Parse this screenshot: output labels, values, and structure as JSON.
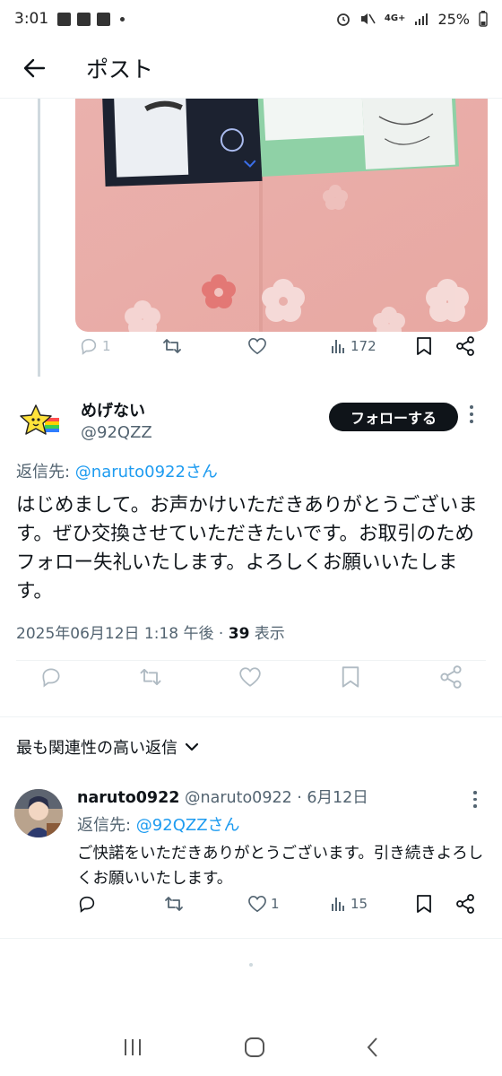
{
  "status_bar": {
    "time": "3:01",
    "network": "4G+",
    "battery": "25%"
  },
  "header": {
    "title": "ポスト"
  },
  "quoted_post_actions": {
    "replies": "1",
    "views": "172"
  },
  "post": {
    "author_name": "めげない",
    "author_handle": "@92QZZ",
    "follow_label": "フォローする",
    "reply_to_prefix": "返信先: ",
    "reply_to_mention": "@naruto0922さん",
    "text": "はじめまして。お声かけいただきありがとうございます。ぜひ交換させていただきたいです。お取引のためフォロー失礼いたします。よろしくお願いいたします。",
    "timestamp": "2025年06月12日 1:18 午後 · ",
    "view_count": "39",
    "view_suffix": " 表示"
  },
  "replies_section": {
    "sort_label": "最も関連性の高い返信"
  },
  "reply": {
    "author_name": "naruto0922",
    "author_meta": " @naruto0922 · 6月12日",
    "reply_to_prefix": "返信先: ",
    "reply_to_mention": "@92QZZさん",
    "text": "ご快諾をいただきありがとうございます。引き続きよろしくお願いいたします。",
    "likes": "1",
    "views": "15"
  },
  "colors": {
    "accent": "#1d9bf0",
    "text": "#0f1419",
    "muted": "#536471",
    "follow_bg": "#0f1419"
  },
  "icons": [
    "back-arrow-icon",
    "reply-icon",
    "retweet-icon",
    "like-icon",
    "views-icon",
    "bookmark-icon",
    "share-icon",
    "chevron-down-icon",
    "more-icon"
  ]
}
